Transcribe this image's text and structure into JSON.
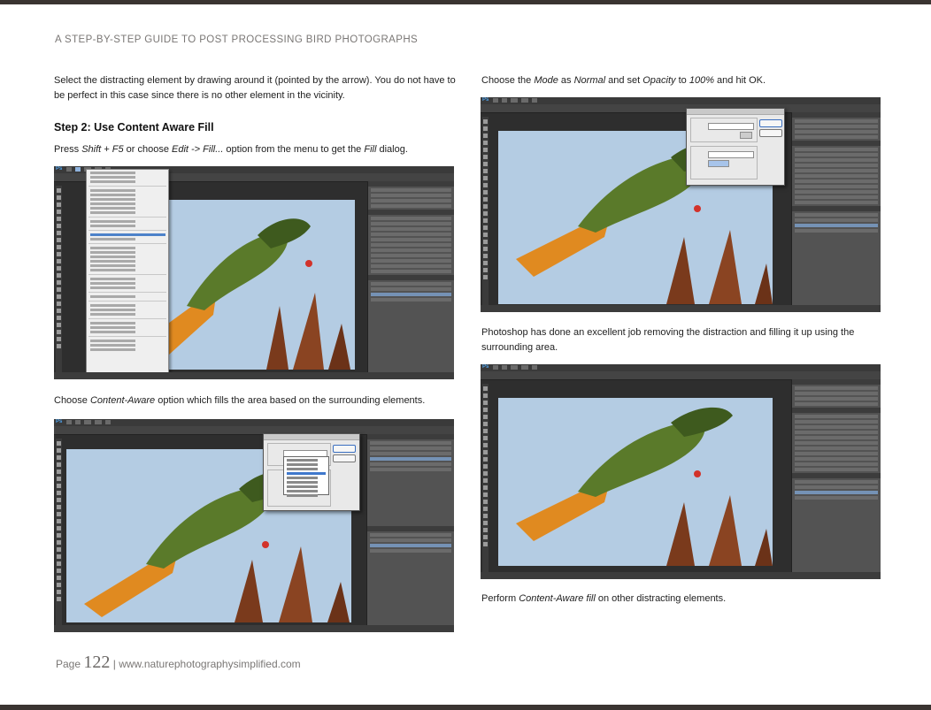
{
  "header": {
    "title": "A STEP-BY-STEP GUIDE TO POST PROCESSING BIRD PHOTOGRAPHS"
  },
  "left": {
    "intro": "Select the distracting element by drawing around it (pointed by the arrow). You do not have to be perfect in this case since there is no other element in the vicinity.",
    "step_title": "Step 2: Use Content Aware Fill",
    "step_text": {
      "a": "Press ",
      "b": "Shift + F5",
      "c": " or choose ",
      "d": "Edit -> Fill...",
      "e": " option from the menu to get the ",
      "f": "Fill",
      "g": " dialog."
    },
    "caption2": {
      "a": "Choose ",
      "b": "Content-Aware",
      "c": " option which fills the area based on the surrounding elements."
    }
  },
  "right": {
    "caption1": {
      "a": "Choose the ",
      "b": "Mode",
      "c": " as ",
      "d": "Normal",
      "e": " and set ",
      "f": "Opacity",
      "g": " to ",
      "h": "100%",
      "i": " and hit OK."
    },
    "caption2": "Photoshop has done an excellent job removing the distraction and filling it up using the surrounding area.",
    "caption3": {
      "a": "Perform ",
      "b": "Content-Aware fill",
      "c": " on other distracting elements."
    }
  },
  "footer": {
    "page_word": "Page",
    "page_number": "122",
    "separator": "|",
    "url": "www.naturephotographysimplified.com"
  },
  "colors": {
    "top_bar": "#3a3431",
    "sky": "#b4cce3",
    "ps_ui": "#2e2e2e",
    "bird_green": "#5a7a2a",
    "bird_tail": "#e08a20",
    "leaves": "#7a3a1c"
  },
  "icons": [
    "photoshop-logo-icon"
  ]
}
